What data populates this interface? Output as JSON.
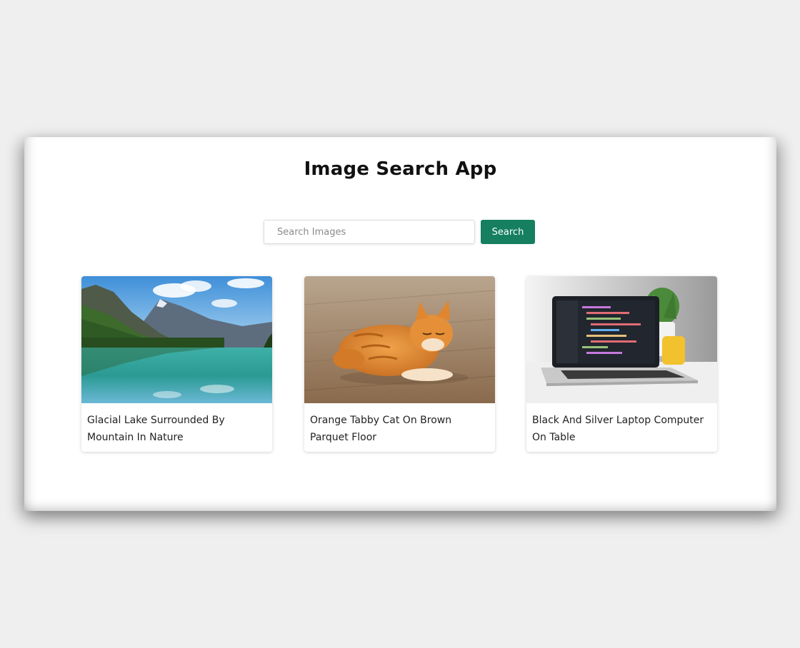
{
  "app": {
    "title": "Image Search App"
  },
  "search": {
    "placeholder": "Search Images",
    "value": "",
    "button_label": "Search"
  },
  "results": [
    {
      "caption": "Glacial Lake Surrounded By Mountain In Nature",
      "image_subject": "lake-mountain-landscape"
    },
    {
      "caption": "Orange Tabby Cat On Brown Parquet Floor",
      "image_subject": "orange-tabby-cat"
    },
    {
      "caption": "Black And Silver Laptop Computer On Table",
      "image_subject": "laptop-computer-on-table"
    }
  ],
  "colors": {
    "page_background": "#efefef",
    "panel_background": "#ffffff",
    "accent": "#157f5f",
    "title_text": "#111111",
    "caption_text": "#222222"
  }
}
